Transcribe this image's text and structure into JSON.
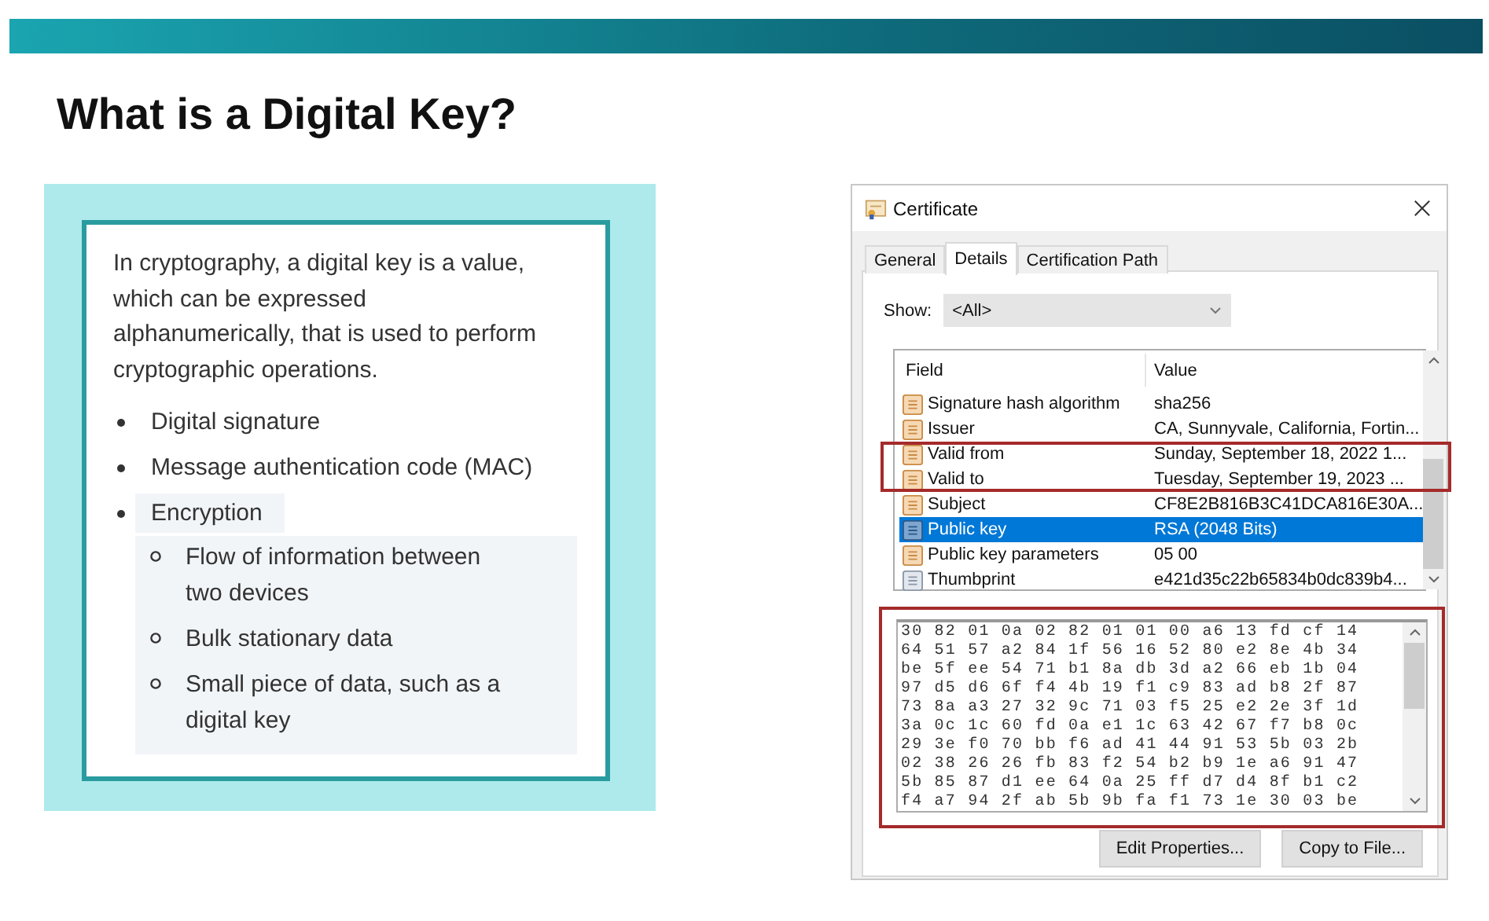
{
  "slide": {
    "title": "What is a Digital Key?",
    "intro": "In cryptography, a digital key is a value, which can be expressed alphanumerically, that is used to perform cryptographic operations.",
    "bullets": [
      {
        "text": "Digital signature"
      },
      {
        "text": "Message authentication code (MAC)"
      },
      {
        "text": "Encryption",
        "children": [
          {
            "text": "Flow of information between two devices"
          },
          {
            "text": "Bulk stationary data"
          },
          {
            "text": "Small piece of data, such as a digital key"
          }
        ]
      }
    ]
  },
  "dialog": {
    "title": "Certificate",
    "tabs": [
      {
        "label": "General",
        "selected": false
      },
      {
        "label": "Details",
        "selected": true
      },
      {
        "label": "Certification Path",
        "selected": false
      }
    ],
    "show_label": "Show:",
    "show_value": "<All>",
    "columns": [
      "Field",
      "Value"
    ],
    "fields": [
      {
        "name": "Signature hash algorithm",
        "value": "sha256",
        "kind": "property",
        "selected": false,
        "highlighted": false
      },
      {
        "name": "Issuer",
        "value": "CA, Sunnyvale, California, Fortin...",
        "kind": "property",
        "selected": false,
        "highlighted": false
      },
      {
        "name": "Valid from",
        "value": "Sunday, September 18, 2022 1...",
        "kind": "property",
        "selected": false,
        "highlighted": true
      },
      {
        "name": "Valid to",
        "value": "Tuesday, September 19, 2023 ...",
        "kind": "property",
        "selected": false,
        "highlighted": true
      },
      {
        "name": "Subject",
        "value": "CF8E2B816B3C41DCA816E30A...",
        "kind": "property",
        "selected": false,
        "highlighted": false
      },
      {
        "name": "Public key",
        "value": "RSA (2048 Bits)",
        "kind": "property",
        "selected": true,
        "highlighted": false
      },
      {
        "name": "Public key parameters",
        "value": "05 00",
        "kind": "property",
        "selected": false,
        "highlighted": false
      },
      {
        "name": "Thumbprint",
        "value": "e421d35c22b65834b0dc839b4...",
        "kind": "computed",
        "selected": false,
        "highlighted": false
      }
    ],
    "hex_lines": [
      "30 82 01 0a 02 82 01 01 00 a6 13 fd cf 14",
      "64 51 57 a2 84 1f 56 16 52 80 e2 8e 4b 34",
      "be 5f ee 54 71 b1 8a db 3d a2 66 eb 1b 04",
      "97 d5 d6 6f f4 4b 19 f1 c9 83 ad b8 2f 87",
      "73 8a a3 27 32 9c 71 03 f5 25 e2 2e 3f 1d",
      "3a 0c 1c 60 fd 0a e1 1c 63 42 67 f7 b8 0c",
      "29 3e f0 70 bb f6 ad 41 44 91 53 5b 03 2b",
      "02 38 26 26 fb 83 f2 54 b2 b9 1e a6 91 47",
      "5b 85 87 d1 ee 64 0a 25 ff d7 d4 8f b1 c2",
      "f4 a7 94 2f ab 5b 9b fa f1 73 1e 30 03 be"
    ],
    "hex_highlighted": true,
    "buttons": [
      "Edit Properties...",
      "Copy to File..."
    ]
  }
}
